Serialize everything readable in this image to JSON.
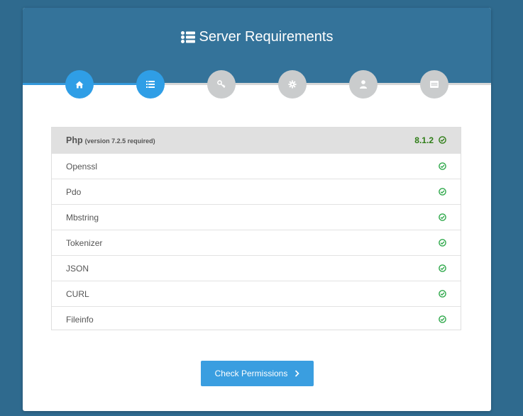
{
  "header": {
    "title": "Server Requirements",
    "title_icon": "list-icon"
  },
  "steps": [
    {
      "icon": "home-icon",
      "state": "done"
    },
    {
      "icon": "list-icon",
      "state": "current"
    },
    {
      "icon": "key-icon",
      "state": "pending"
    },
    {
      "icon": "gear-icon",
      "state": "pending"
    },
    {
      "icon": "user-icon",
      "state": "pending"
    },
    {
      "icon": "server-icon",
      "state": "pending"
    }
  ],
  "requirements": {
    "php": {
      "name": "Php",
      "note": "(version 7.2.5 required)",
      "version": "8.1.2",
      "status": "ok"
    },
    "extensions": [
      {
        "name": "Openssl",
        "status": "ok"
      },
      {
        "name": "Pdo",
        "status": "ok"
      },
      {
        "name": "Mbstring",
        "status": "ok"
      },
      {
        "name": "Tokenizer",
        "status": "ok"
      },
      {
        "name": "JSON",
        "status": "ok"
      },
      {
        "name": "CURL",
        "status": "ok"
      },
      {
        "name": "Fileinfo",
        "status": "ok"
      }
    ]
  },
  "actions": {
    "check_permissions": "Check Permissions"
  },
  "colors": {
    "header_bg": "#34739a",
    "page_bg": "#2f6a8e",
    "step_active": "#2f9ee6",
    "step_inactive": "#cacccd",
    "ok_green": "#2ea84a",
    "version_green": "#2e7d16",
    "button": "#3a9ee0"
  }
}
